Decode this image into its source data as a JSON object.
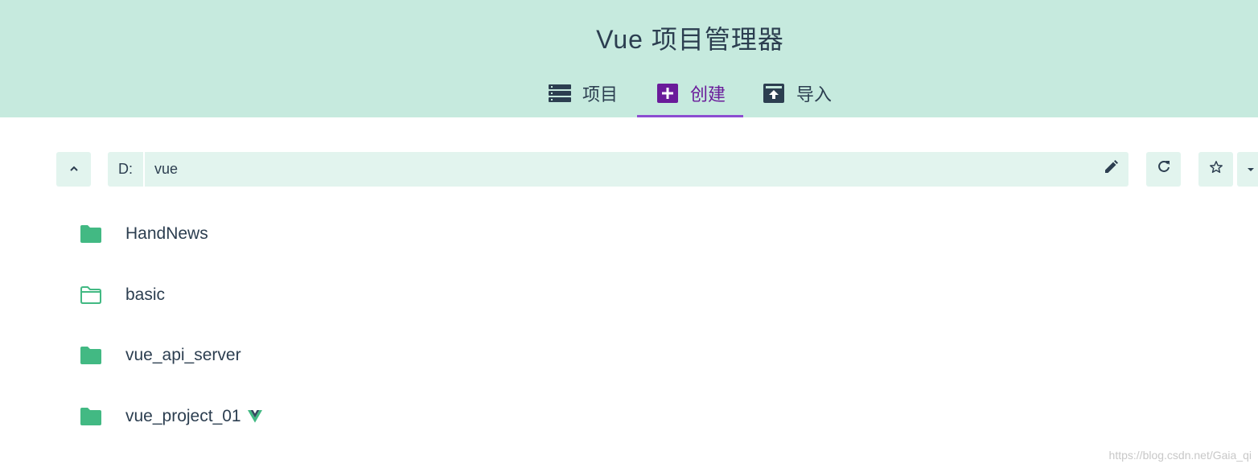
{
  "header": {
    "title": "Vue 项目管理器",
    "tabs": [
      {
        "label": "项目",
        "icon": "list-icon"
      },
      {
        "label": "创建",
        "icon": "add-box-icon"
      },
      {
        "label": "导入",
        "icon": "unarchive-icon"
      }
    ],
    "active_tab": "创建"
  },
  "toolbar": {
    "up_icon": "chevron-up-icon",
    "drive": "D:",
    "path_segment": "vue",
    "edit_icon": "pencil-icon",
    "refresh_icon": "refresh-icon",
    "favorite_icon": "star-outline-icon",
    "more_icon": "caret-down-icon"
  },
  "folders": [
    {
      "name": "HandNews",
      "icon": "folder-filled-icon"
    },
    {
      "name": "basic",
      "icon": "folder-open-outline-icon"
    },
    {
      "name": "vue_api_server",
      "icon": "folder-filled-icon"
    },
    {
      "name": "vue_project_01",
      "icon": "folder-filled-icon",
      "badge": "vue-logo-icon"
    }
  ],
  "watermark": "https://blog.csdn.net/Gaia_qi",
  "colors": {
    "header_bg": "#c6eade",
    "accent_purple": "#8c4dd1",
    "active_icon_bg": "#6a1b9a",
    "folder_green": "#42b983",
    "toolbar_bg": "#e2f4ee",
    "text": "#2c3e50"
  }
}
